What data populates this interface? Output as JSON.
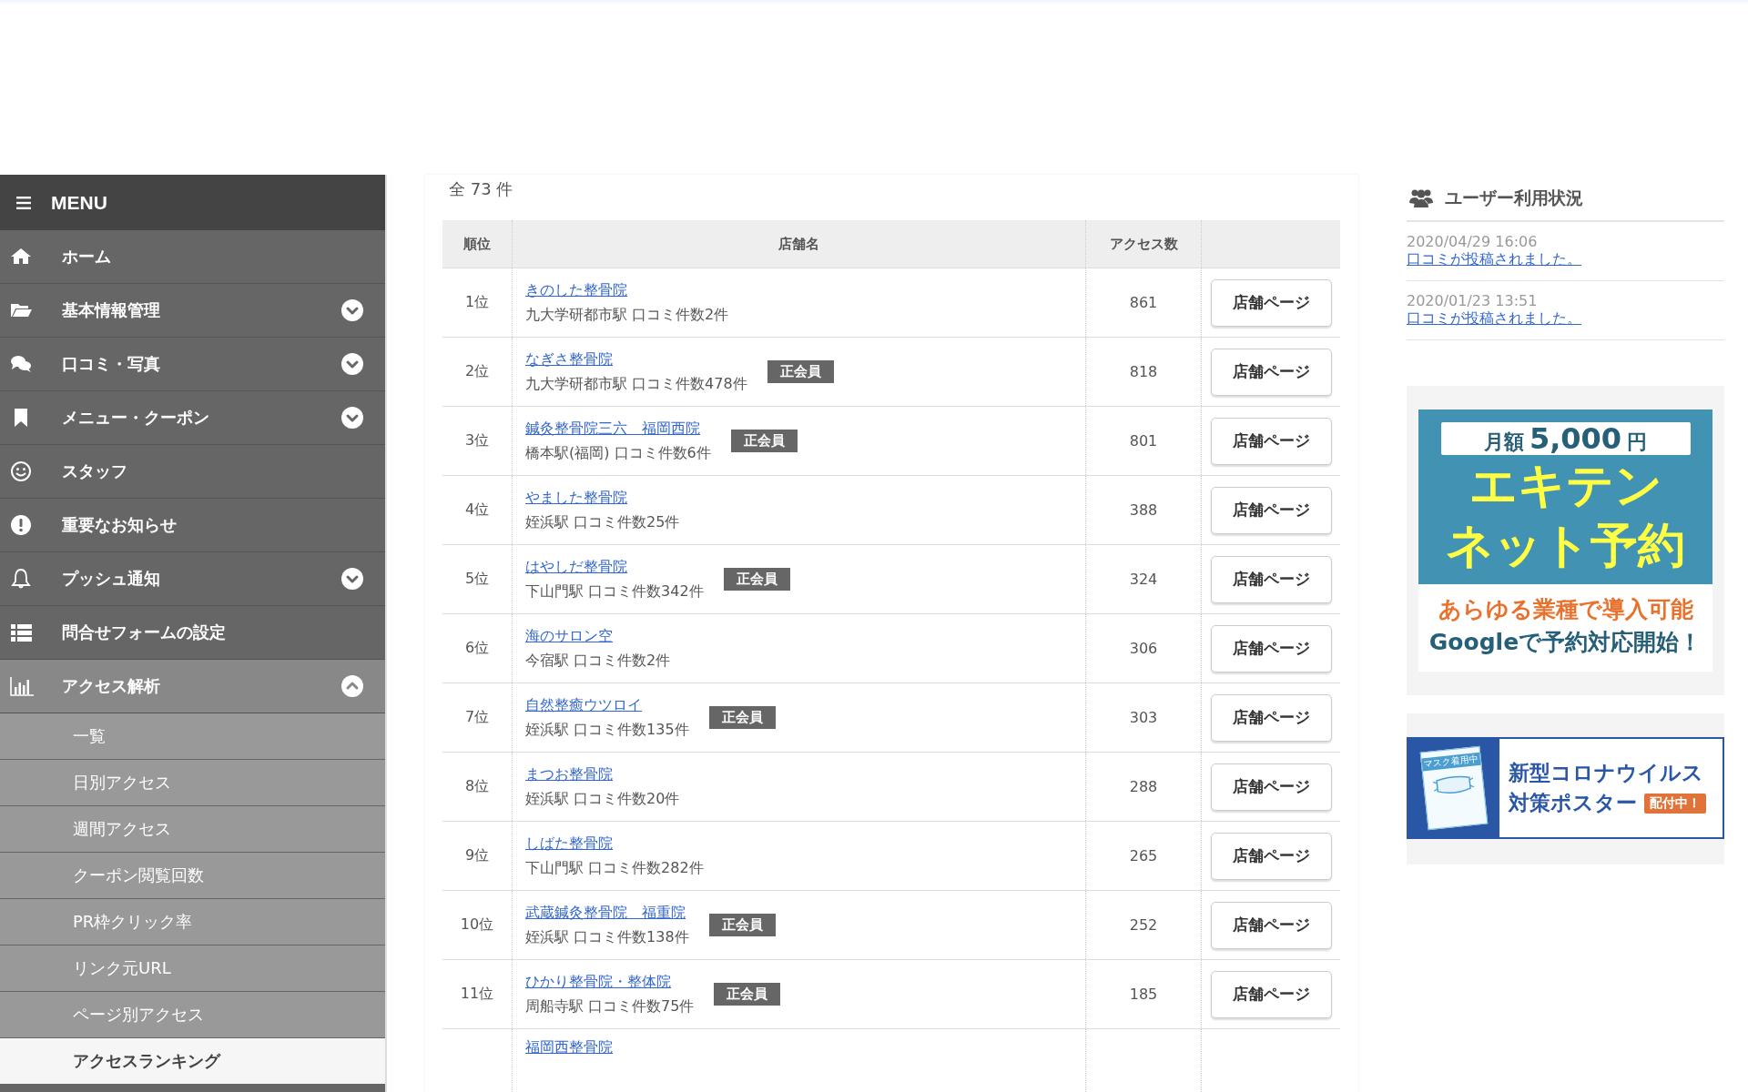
{
  "sidebar": {
    "title": "MENU",
    "items": [
      {
        "label": "ホーム"
      },
      {
        "label": "基本情報管理",
        "expanded": false
      },
      {
        "label": "口コミ・写真",
        "expanded": false
      },
      {
        "label": "メニュー・クーポン",
        "expanded": false
      },
      {
        "label": "スタッフ"
      },
      {
        "label": "重要なお知らせ"
      },
      {
        "label": "プッシュ通知",
        "expanded": false
      },
      {
        "label": "問合せフォームの設定"
      },
      {
        "label": "アクセス解析",
        "expanded": true,
        "children": [
          {
            "label": "一覧",
            "selected": false
          },
          {
            "label": "日別アクセス",
            "selected": false
          },
          {
            "label": "週間アクセス",
            "selected": false
          },
          {
            "label": "クーポン閲覧回数",
            "selected": false
          },
          {
            "label": "PR枠クリック率",
            "selected": false
          },
          {
            "label": "リンク元URL",
            "selected": false
          },
          {
            "label": "ページ別アクセス",
            "selected": false
          },
          {
            "label": "アクセスランキング",
            "selected": true
          }
        ]
      }
    ]
  },
  "ranking": {
    "total": "全 73 件",
    "columns": [
      "順位",
      "店舗名",
      "アクセス数"
    ],
    "rows": [
      {
        "rank": "1位",
        "name": "きのした整骨院",
        "meta": "九大学研都市駅 口コミ件数2件",
        "count": "861",
        "button": "店舗ページ"
      },
      {
        "rank": "2位",
        "name": "なぎさ整骨院",
        "meta": "九大学研都市駅 口コミ件数478件",
        "badge": "正会員",
        "count": "818",
        "button": "店舗ページ"
      },
      {
        "rank": "3位",
        "name": "鍼灸整骨院三六　福岡西院",
        "meta": "橋本駅(福岡) 口コミ件数6件",
        "badge": "正会員",
        "count": "801",
        "button": "店舗ページ"
      },
      {
        "rank": "4位",
        "name": "やました整骨院",
        "meta": "姪浜駅 口コミ件数25件",
        "count": "388",
        "button": "店舗ページ"
      },
      {
        "rank": "5位",
        "name": "はやしだ整骨院",
        "meta": "下山門駅 口コミ件数342件",
        "badge": "正会員",
        "count": "324",
        "button": "店舗ページ"
      },
      {
        "rank": "6位",
        "name": "海のサロン空",
        "meta": "今宿駅 口コミ件数2件",
        "count": "306",
        "button": "店舗ページ"
      },
      {
        "rank": "7位",
        "name": "自然整癒ウツロイ",
        "meta": "姪浜駅 口コミ件数135件",
        "badge": "正会員",
        "count": "303",
        "button": "店舗ページ"
      },
      {
        "rank": "8位",
        "name": "まつお整骨院",
        "meta": "姪浜駅 口コミ件数20件",
        "count": "288",
        "button": "店舗ページ"
      },
      {
        "rank": "9位",
        "name": "しばた整骨院",
        "meta": "下山門駅 口コミ件数282件",
        "count": "265",
        "button": "店舗ページ"
      },
      {
        "rank": "10位",
        "name": "武蔵鍼灸整骨院　福重院",
        "meta": "姪浜駅 口コミ件数138件",
        "badge": "正会員",
        "count": "252",
        "button": "店舗ページ"
      },
      {
        "rank": "11位",
        "name": "ひかり整骨院・整体院",
        "meta": "周船寺駅 口コミ件数75件",
        "badge": "正会員",
        "count": "185",
        "button": "店舗ページ"
      },
      {
        "name": "福岡西整骨院"
      }
    ]
  },
  "usage": {
    "title": "ユーザー利用状況",
    "entries": [
      {
        "date": "2020/04/29 16:06",
        "text": "口コミが投稿されました。"
      },
      {
        "date": "2020/01/23 13:51",
        "text": "口コミが投稿されました。"
      }
    ]
  },
  "banners": [
    {
      "kind": "reservation",
      "price_label": "月額",
      "price": "5,000",
      "unit": "円",
      "headline": [
        "エキテン",
        "ネット予約"
      ],
      "lines": [
        "あらゆる業種で導入可能",
        "Googleで予約対応開始！"
      ]
    },
    {
      "kind": "poster",
      "poster_text": "マスク着用中",
      "lines": [
        "新型コロナウイルス",
        "対策ポスター"
      ],
      "tag": "配付中！"
    }
  ]
}
